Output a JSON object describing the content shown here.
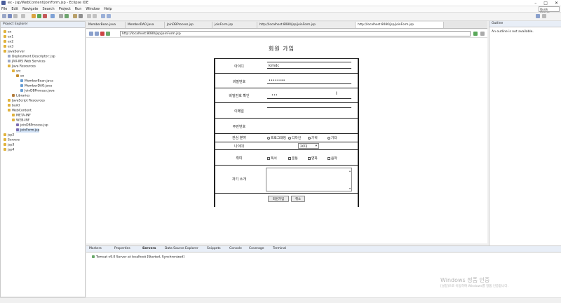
{
  "window": {
    "title": "ex - jsp/WebContent/joinForm.jsp - Eclipse IDE",
    "controls": [
      "–",
      "□",
      "✕"
    ]
  },
  "menu": {
    "items": [
      "File",
      "Edit",
      "Navigate",
      "Search",
      "Project",
      "Run",
      "Window",
      "Help"
    ],
    "quick_access": "Quick Access"
  },
  "left_panel": {
    "tab": "Project Explorer",
    "tree": [
      "ex",
      "ex1",
      "ex2",
      "ex3",
      "JavaServer",
      "Deployment Descriptor: jsp",
      "JAX-WS Web Services",
      "Java Resources",
      "src",
      "ex",
      "MemberBean.java",
      "MemberDAO.java",
      "JoinDBProcess.java",
      "Libraries",
      "JavaScript Resources",
      "build",
      "WebContent",
      "META-INF",
      "WEB-INF",
      "joinDBProcess.jsp",
      "joinForm.jsp",
      "jsp2",
      "Servers",
      "jsp3",
      "jsp4"
    ]
  },
  "editor": {
    "tabs": [
      "MemberBean.java",
      "MemberDAO.java",
      "JoinDBProcess.jsp",
      "joinForm.jsp",
      "http://localhost:8080/jsp/joinForm.jsp",
      "http://localhost:8080/jsp/joinForm.jsp"
    ],
    "url": "http://localhost:8080/jsp/joinForm.jsp"
  },
  "form": {
    "title": "회원 가입",
    "rows": [
      {
        "label": "아이디",
        "value": "kimdc"
      },
      {
        "label": "비밀번호",
        "value": "••••••••"
      },
      {
        "label": "비밀번호 확인",
        "value": "•••"
      },
      {
        "label": "이메일",
        "value": ""
      },
      {
        "label": "주민번호",
        "value": ""
      }
    ],
    "job_label": "관심 분야",
    "job_options": [
      "프로그래밍",
      "디자인",
      "기획",
      "기타"
    ],
    "age_label": "나이대",
    "age_value": "20대",
    "hobby_label": "취미",
    "hobby_options": [
      "독서",
      "운동",
      "영화",
      "음악"
    ],
    "intro_label": "자기 소개",
    "submit_label": "회원가입",
    "reset_label": "취소"
  },
  "right_panel": {
    "tab": "Outline",
    "message": "An outline is not available."
  },
  "bottom_panel": {
    "tabs": [
      "Markers",
      "Properties",
      "Servers",
      "Data Source Explorer",
      "Snippets",
      "Console",
      "Coverage",
      "Terminal"
    ],
    "server_entry": "Tomcat v9.0 Server at localhost [Started, Synchronized]"
  },
  "watermark": {
    "title": "Windows 정품 인증",
    "subtitle": "[설정]으로 이동하여 Windows를 정품 인증합니다."
  },
  "colors": {
    "accent": "#4a5d9a",
    "folder": "#e0b23c",
    "java": "#6a9fd4",
    "jsp": "#7c6bb0"
  }
}
